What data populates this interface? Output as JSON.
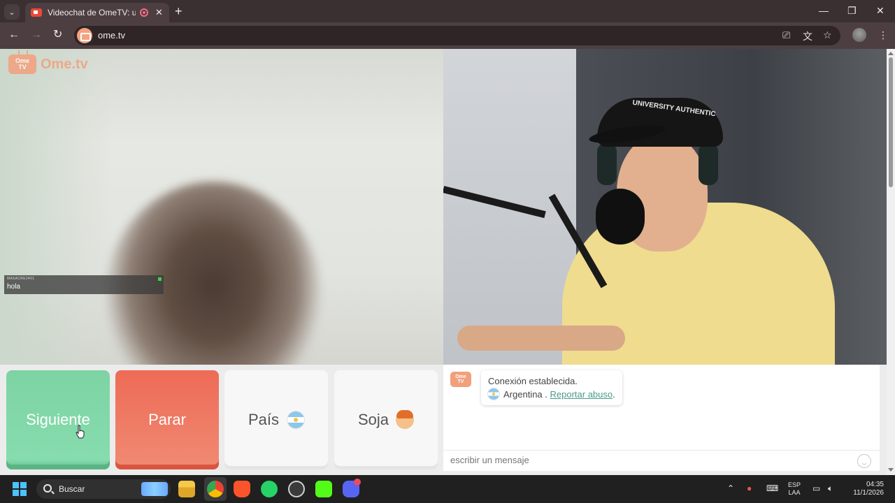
{
  "browser": {
    "tab_title": "Videochat de OmeTV: una a",
    "tab_close": "✕",
    "new_tab": "+",
    "url": "ome.tv",
    "window_controls": {
      "minimize": "—",
      "maximize": "❐",
      "close": "✕"
    }
  },
  "logo": {
    "badge_top": "Ome",
    "badge_bottom": "TV",
    "text": "Ome.tv"
  },
  "stranger_chat": {
    "username": "MASACRE2491",
    "message": "hola"
  },
  "buttons": {
    "next": "Siguiente",
    "stop": "Parar",
    "country": "País",
    "gender": "Soja"
  },
  "chat": {
    "status": "Conexión establecida.",
    "country": "Argentina",
    "separator": " . ",
    "report_link": "Reportar abuso",
    "trailing": ".",
    "input_placeholder": "escribir un mensaje"
  },
  "webcam": {
    "cap_text": "UNIVERSITY AUTHENTIC"
  },
  "taskbar": {
    "search_placeholder": "Buscar",
    "lang_top": "ESP",
    "lang_bottom": "LAA",
    "time": "04:35",
    "date": "11/1/2026"
  },
  "colors": {
    "next": "#86dcae",
    "stop": "#ee6b56",
    "brand": "#f2a07c",
    "link": "#4c9a8c"
  }
}
